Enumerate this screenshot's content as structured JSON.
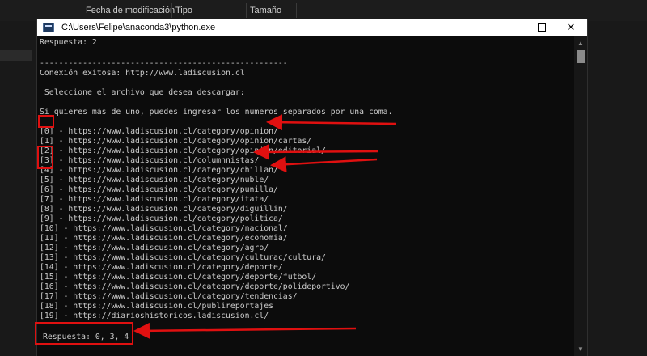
{
  "explorer": {
    "columns": [
      "Fecha de modificación",
      "Tipo",
      "Tamaño"
    ]
  },
  "console": {
    "title": "C:\\Users\\Felipe\\anaconda3\\python.exe",
    "lines": [
      "Respuesta: 2",
      "",
      "----------------------------------------------------",
      "Conexión exitosa: http://www.ladiscusion.cl",
      "",
      " Seleccione el archivo que desea descargar:",
      "",
      "Si quieres más de uno, puedes ingresar los numeros separados por una coma.",
      "",
      "[0] - https://www.ladiscusion.cl/category/opinion/",
      "[1] - https://www.ladiscusion.cl/category/opinion/cartas/",
      "[2] - https://www.ladiscusion.cl/category/opinion/editorial/",
      "[3] - https://www.ladiscusion.cl/columnnistas/",
      "[4] - https://www.ladiscusion.cl/category/chillan/",
      "[5] - https://www.ladiscusion.cl/category/nuble/",
      "[6] - https://www.ladiscusion.cl/category/punilla/",
      "[7] - https://www.ladiscusion.cl/category/itata/",
      "[8] - https://www.ladiscusion.cl/category/diguillin/",
      "[9] - https://www.ladiscusion.cl/category/politica/",
      "[10] - https://www.ladiscusion.cl/category/nacional/",
      "[11] - https://www.ladiscusion.cl/category/economia/",
      "[12] - https://www.ladiscusion.cl/category/agro/",
      "[13] - https://www.ladiscusion.cl/category/culturac/cultura/",
      "[14] - https://www.ladiscusion.cl/category/deporte/",
      "[15] - https://www.ladiscusion.cl/category/deporte/futbol/",
      "[16] - https://www.ladiscusion.cl/category/deporte/polideportivo/",
      "[17] - https://www.ladiscusion.cl/category/tendencias/",
      "[18] - https://www.ladiscusion.cl/publireportajes",
      "[19] - https://diarioshistoricos.ladiscusion.cl/",
      "",
      "Respuesta: 0, 3, 4"
    ]
  },
  "colors": {
    "annotation": "#e01010",
    "console_bg": "#0c0c0c",
    "console_text": "#cccccc"
  }
}
